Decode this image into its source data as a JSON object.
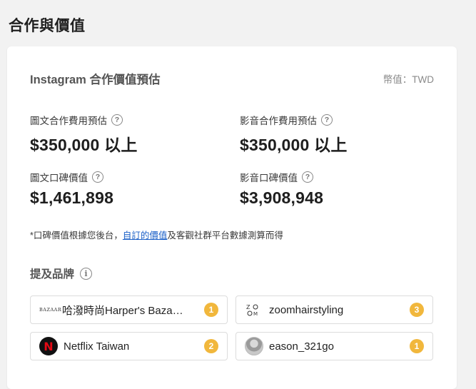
{
  "page_title": "合作與價值",
  "card": {
    "title": "Instagram 合作價值預估",
    "currency": "幣值：TWD"
  },
  "metrics": [
    {
      "label": "圖文合作費用預估",
      "value": "$350,000 以上"
    },
    {
      "label": "影音合作費用預估",
      "value": "$350,000 以上"
    },
    {
      "label": "圖文口碑價值",
      "value": "$1,461,898"
    },
    {
      "label": "影音口碑價值",
      "value": "$3,908,948"
    }
  ],
  "help_glyph": "?",
  "footnote": {
    "prefix": "*口碑價值根據您後台，",
    "link": "自訂的價值",
    "suffix": "及客觀社群平台數據測算而得"
  },
  "brands": {
    "header": "提及品牌",
    "info_glyph": "i",
    "items": [
      {
        "logo_text": "BAZAAR",
        "name": "哈潑時尚Harper's Baza…",
        "count": "1"
      },
      {
        "logo_text": "ZOOM",
        "name": "zoomhairstyling",
        "count": "3"
      },
      {
        "logo_text": "N",
        "name": "Netflix Taiwan",
        "count": "2"
      },
      {
        "logo_text": "",
        "name": "eason_321go",
        "count": "1"
      }
    ]
  },
  "colors": {
    "badge": "#f1b73c",
    "link": "#1a5fc7",
    "netflix_red": "#e50914"
  }
}
